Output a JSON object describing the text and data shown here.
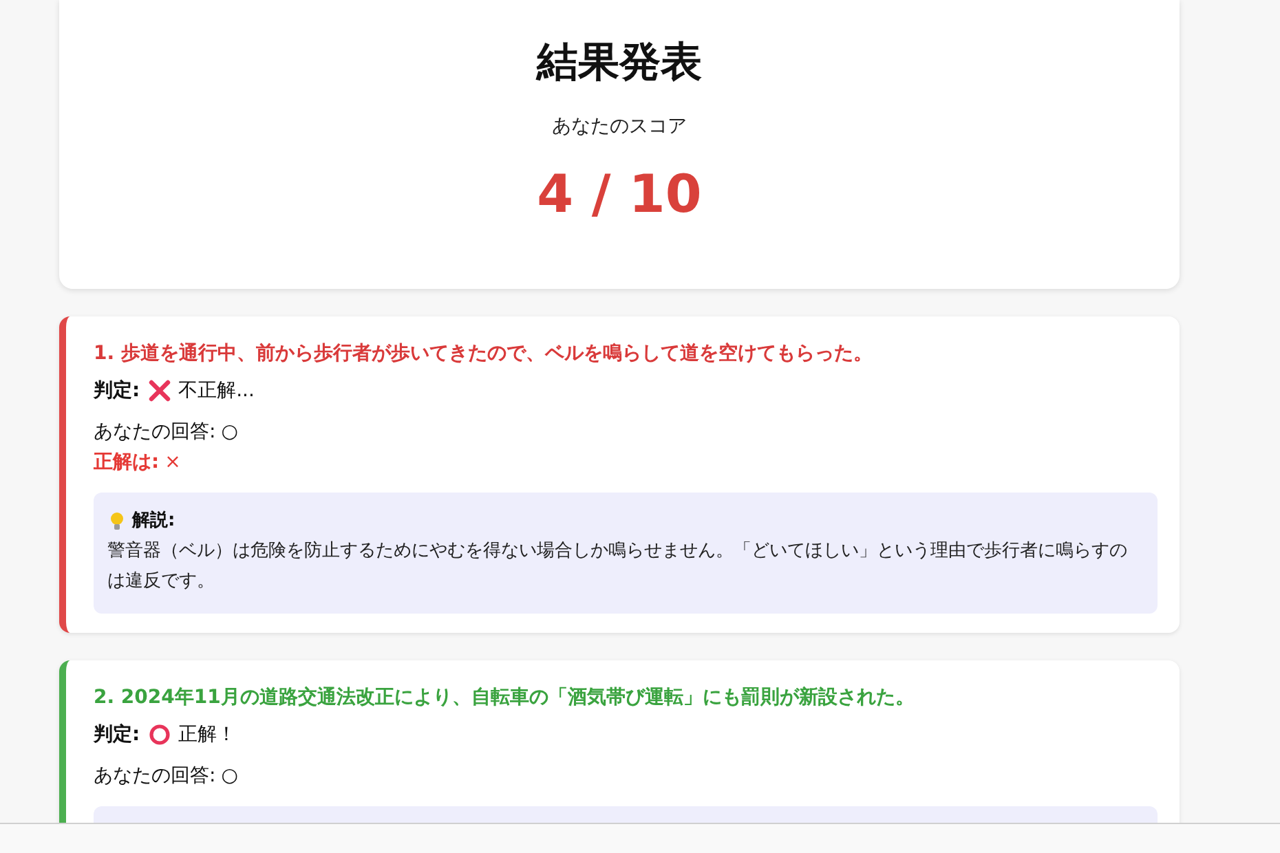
{
  "header": {
    "title": "結果発表",
    "score_label": "あなたのスコア",
    "score": "4 / 10"
  },
  "questions": [
    {
      "question": "1. 歩道を通行中、前から歩行者が歩いてきたので、ベルを鳴らして道を空けてもらった。",
      "correct": false,
      "verdict_label": "判定:",
      "verdict": "不正解...",
      "answer_label": "あなたの回答:",
      "answer": "○",
      "correct_answer_label": "正解は:",
      "correct_answer": "×",
      "explanation_title": "解説:",
      "explanation": "警音器（ベル）は危険を防止するためにやむを得ない場合しか鳴らせません。「どいてほしい」という理由で歩行者に鳴らすのは違反です。"
    },
    {
      "question": "2. 2024年11月の道路交通法改正により、自転車の「酒気帯び運転」にも罰則が新設された。",
      "correct": true,
      "verdict_label": "判定:",
      "verdict": "正解！",
      "answer_label": "あなたの回答:",
      "answer": "○"
    }
  ]
}
